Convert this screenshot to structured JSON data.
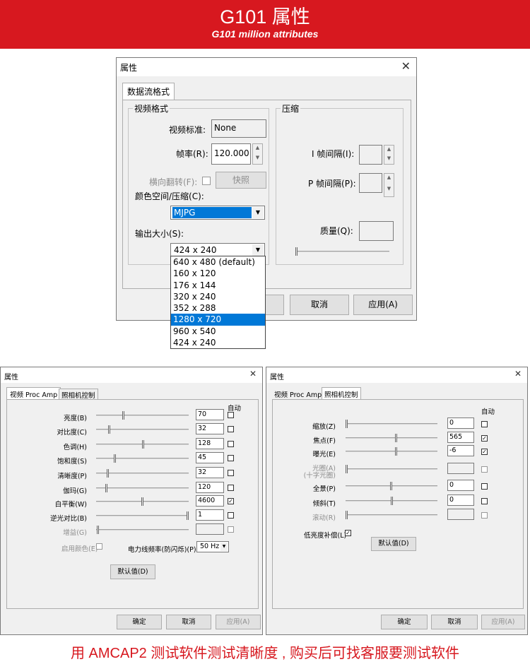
{
  "banner": {
    "title": "G101 属性",
    "subtitle": "G101 million attributes"
  },
  "dialog1": {
    "title": "属性",
    "tab": "数据流格式",
    "video_group": "视频格式",
    "compress_group": "压缩",
    "video_standard_label": "视频标准:",
    "video_standard_value": "None",
    "frame_rate_label": "帧率(R):",
    "frame_rate_value": "120.000",
    "flip_label": "横向翻转(F):",
    "snapshot_button": "快照",
    "color_space_label": "颜色空间/压缩(C):",
    "color_space_value": "MJPG",
    "output_size_label": "输出大小(S):",
    "output_size_value": "424 x 240",
    "output_size_options": [
      "640 x 480  (default)",
      "160 x 120",
      "176 x 144",
      "320 x 240",
      "352 x 288",
      "1280 x 720",
      "960 x 540",
      "424 x 240"
    ],
    "iframe_label": "I 帧间隔(I):",
    "pframe_label": "P 帧间隔(P):",
    "quality_label": "质量(Q):",
    "cancel_button": "取消",
    "apply_button": "应用(A)"
  },
  "dialog2": {
    "title": "属性",
    "tabs": [
      "视频 Proc Amp",
      "照相机控制"
    ],
    "auto_header": "自动",
    "rows": [
      {
        "label": "亮度(B)",
        "value": "70",
        "checked": false,
        "disabled": false
      },
      {
        "label": "对比度(C)",
        "value": "32",
        "checked": false,
        "disabled": false
      },
      {
        "label": "色调(H)",
        "value": "128",
        "checked": false,
        "disabled": false
      },
      {
        "label": "饱和度(S)",
        "value": "45",
        "checked": false,
        "disabled": false
      },
      {
        "label": "清晰度(P)",
        "value": "32",
        "checked": false,
        "disabled": false
      },
      {
        "label": "伽玛(G)",
        "value": "120",
        "checked": false,
        "disabled": false
      },
      {
        "label": "白平衡(W)",
        "value": "4600",
        "checked": true,
        "disabled": false
      },
      {
        "label": "逆光对比(B)",
        "value": "1",
        "checked": false,
        "disabled": false
      },
      {
        "label": "增益(G)",
        "value": "",
        "checked": false,
        "disabled": true
      }
    ],
    "color_enable_label": "启用颜色(E)",
    "powerline_label": "电力线频率(防闪烁)(P)",
    "powerline_value": "50 Hz",
    "default_button": "默认值(D)",
    "ok_button": "确定",
    "cancel_button": "取消",
    "apply_button": "应用(A)"
  },
  "dialog3": {
    "title": "属性",
    "tabs": [
      "视频 Proc Amp",
      "照相机控制"
    ],
    "auto_header": "自动",
    "rows": [
      {
        "label": "缩放(Z)",
        "value": "0",
        "checked": false,
        "disabled": false
      },
      {
        "label": "焦点(F)",
        "value": "565",
        "checked": true,
        "disabled": false
      },
      {
        "label": "曝光(E)",
        "value": "-6",
        "checked": true,
        "disabled": false
      },
      {
        "label": "光圈(A)",
        "label2": "(十字光圈)",
        "value": "",
        "checked": false,
        "disabled": true
      },
      {
        "label": "全景(P)",
        "value": "0",
        "checked": false,
        "disabled": false
      },
      {
        "label": "倾斜(T)",
        "value": "0",
        "checked": false,
        "disabled": false
      },
      {
        "label": "滚动(R)",
        "value": "",
        "checked": false,
        "disabled": true
      }
    ],
    "low_light_label": "低亮度补偿(L)",
    "default_button": "默认值(D)",
    "ok_button": "确定",
    "cancel_button": "取消",
    "apply_button": "应用(A)"
  },
  "footer": {
    "text": "用 AMCAP2 测试软件测试清晰度 , 购买后可找客服要测试软件"
  }
}
